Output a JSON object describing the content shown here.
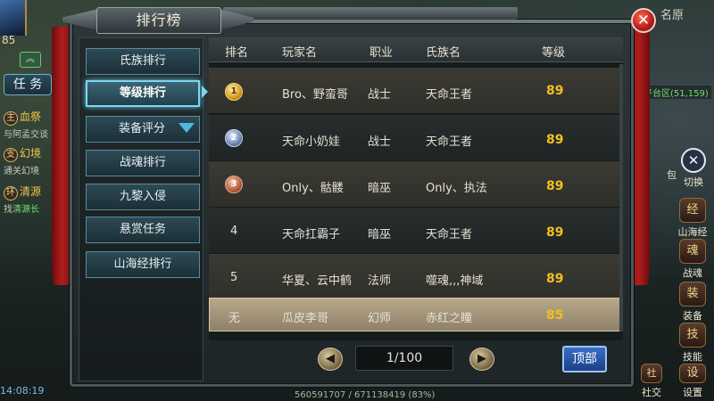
{
  "hud": {
    "player_level": "85",
    "arrow_up": "︽",
    "task_button": "任 务",
    "quests": [
      {
        "tag": "主",
        "name": "血祭",
        "desc": "与阿孟交谈"
      },
      {
        "tag": "支",
        "name": "幻境",
        "desc": "通关幻境"
      },
      {
        "tag": "环",
        "name": "清源",
        "desc_prefix": "找",
        "desc_green": "清源长"
      }
    ],
    "clock": "14:08:19",
    "zone_name": "名原",
    "coords": "平台区(51,159)",
    "bag_label": "包",
    "switch_label": "切换",
    "switch_icon": "✕",
    "side_buttons": [
      {
        "label": "山海经",
        "icon": "经"
      },
      {
        "label": "战魂",
        "icon": "魂"
      },
      {
        "label": "装备",
        "icon": "装"
      },
      {
        "label": "技能",
        "icon": "技"
      },
      {
        "label": "社交",
        "icon": "社"
      },
      {
        "label": "设置",
        "icon": "设"
      }
    ],
    "exp_text": "560591707 / 671138419 (83%)"
  },
  "dialog": {
    "title": "排行榜",
    "close_icon": "✕",
    "menu": [
      {
        "label": "氏族排行",
        "active": false
      },
      {
        "label": "等级排行",
        "active": true
      },
      {
        "label": "装备评分",
        "active": false
      },
      {
        "label": "战魂排行",
        "active": false
      },
      {
        "label": "九黎入侵",
        "active": false
      },
      {
        "label": "悬赏任务",
        "active": false
      },
      {
        "label": "山海经排行",
        "active": false
      }
    ],
    "table": {
      "headers": [
        "排名",
        "玩家名",
        "职业",
        "氏族名",
        "等级"
      ],
      "rows": [
        {
          "rank": "1",
          "medal": "gold",
          "name": "Bro、野蛮哥",
          "class": "战士",
          "clan": "天命王者",
          "level": "89"
        },
        {
          "rank": "2",
          "medal": "silver",
          "name": "天命小奶娃",
          "class": "战士",
          "clan": "天命王者",
          "level": "89"
        },
        {
          "rank": "3",
          "medal": "bronze",
          "name": "Only、骷髅",
          "class": "暗巫",
          "clan": "Only、执法",
          "level": "89"
        },
        {
          "rank": "4",
          "medal": "",
          "name": "天命扛霸子",
          "class": "暗巫",
          "clan": "天命王者",
          "level": "89"
        },
        {
          "rank": "5",
          "medal": "",
          "name": "华夏、云中鹤",
          "class": "法师",
          "clan": "噬魂,,,神域",
          "level": "89"
        },
        {
          "rank": "无",
          "medal": "",
          "name": "瓜皮李哥",
          "class": "幻师",
          "clan": "赤红之瞳",
          "level": "85",
          "mine": true
        }
      ]
    },
    "pager": {
      "prev_icon": "◀",
      "next_icon": "▶",
      "page": "1/100",
      "top_button": "顶部"
    }
  },
  "colors": {
    "level_gold": "#f2c020",
    "active_tab_glow": "#7fd6f0",
    "top_button_blue": "#2a5bb0",
    "close_red": "#b81a16"
  }
}
